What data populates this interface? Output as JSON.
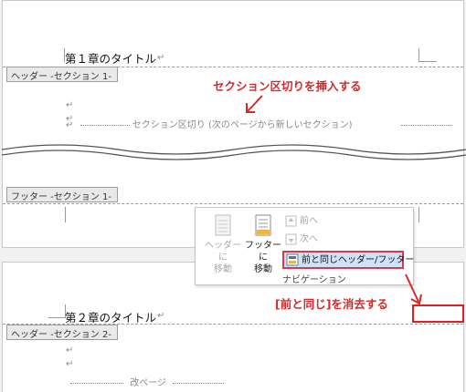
{
  "page1": {
    "chapter_title": "第１章のタイトル",
    "header_tab": "ヘッダー -セクション 1-",
    "break_label": "セクション区切り (次のページから新しいセクション)",
    "footer_tab": "フッター -セクション 1-"
  },
  "page2": {
    "chapter_title": "第２章のタイトル",
    "header_tab": "ヘッダー -セクション 2-",
    "break_label": "改ページ"
  },
  "paragraph_mark": "↵",
  "annotations": {
    "insert_section_break": "セクション区切りを挿入する",
    "clear_link": "[前と同じ]を消去する",
    "color": "#d42a2a"
  },
  "ribbon": {
    "goto_header": [
      "ヘッダーに",
      "移動"
    ],
    "goto_footer": [
      "フッターに",
      "移動"
    ],
    "previous": "前へ",
    "next": "次へ",
    "link_to_previous": "前と同じヘッダー/フッター",
    "group_label": "ナビゲーション"
  }
}
